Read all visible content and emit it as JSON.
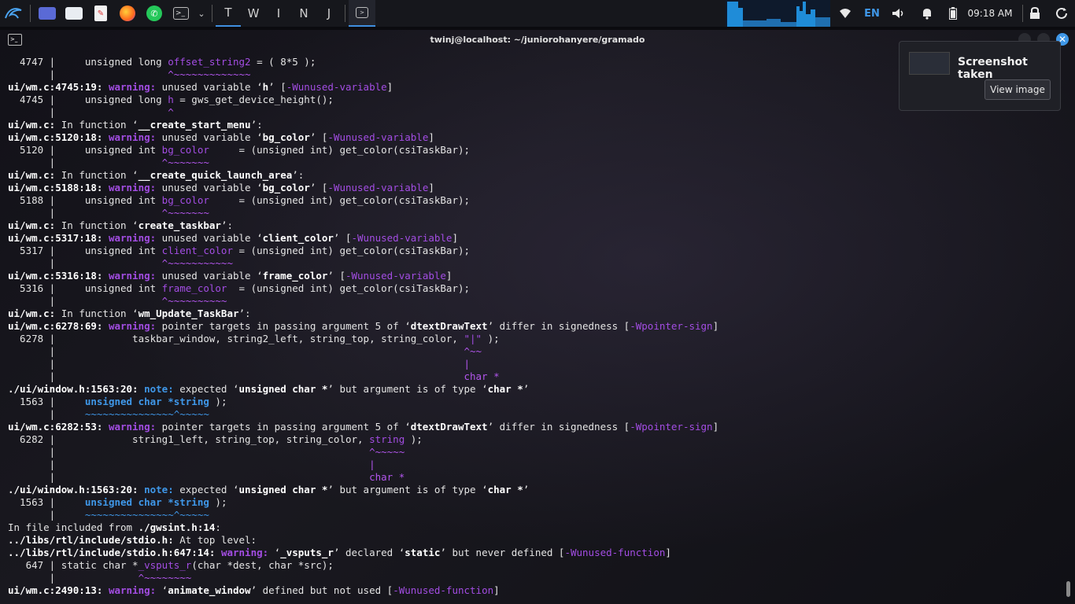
{
  "panel": {
    "workspaces": [
      "T",
      "W",
      "I",
      "N",
      "J"
    ],
    "keyboard_layout": "EN",
    "clock": "09:18 AM",
    "accent_color": "#3f8fe0",
    "icons": [
      "kali-menu-icon",
      "desktop-icon",
      "file-manager-icon",
      "text-editor-icon",
      "firefox-icon",
      "whatsapp-icon",
      "terminal-icon",
      "dropdown-icon",
      "wifi-icon",
      "volume-icon",
      "notifications-icon",
      "battery-icon",
      "lock-icon",
      "power-icon"
    ]
  },
  "terminal": {
    "title": "twinj@localhost: ~/juniorohanyere/gramado"
  },
  "notification": {
    "title": "Screenshot taken",
    "button": "View image"
  },
  "output": [
    [
      [
        "  4747 |     unsigned long ",
        ""
      ],
      [
        "offset_string2",
        "p"
      ],
      [
        " = ( 8*5 );",
        ""
      ]
    ],
    [
      [
        "       |                   ",
        ""
      ],
      [
        "^~~~~~~~~~~~~~",
        "c"
      ]
    ],
    [
      [
        "ui/wm.c:4745:19: ",
        "b"
      ],
      [
        "warning: ",
        "w"
      ],
      [
        "unused variable ‘",
        ""
      ],
      [
        "h",
        "b"
      ],
      [
        "’ [",
        ""
      ],
      [
        "-Wunused-variable",
        "p"
      ],
      [
        "]",
        ""
      ]
    ],
    [
      [
        "  4745 |     unsigned long ",
        ""
      ],
      [
        "h",
        "p"
      ],
      [
        " = gws_get_device_height();",
        ""
      ]
    ],
    [
      [
        "       |                   ",
        ""
      ],
      [
        "^",
        "c"
      ]
    ],
    [
      [
        "ui/wm.c:",
        "b"
      ],
      [
        " In function ‘",
        ""
      ],
      [
        "__create_start_menu",
        "b"
      ],
      [
        "’:",
        ""
      ]
    ],
    [
      [
        "ui/wm.c:5120:18: ",
        "b"
      ],
      [
        "warning: ",
        "w"
      ],
      [
        "unused variable ‘",
        ""
      ],
      [
        "bg_color",
        "b"
      ],
      [
        "’ [",
        ""
      ],
      [
        "-Wunused-variable",
        "p"
      ],
      [
        "]",
        ""
      ]
    ],
    [
      [
        "  5120 |     unsigned int ",
        ""
      ],
      [
        "bg_color",
        "p"
      ],
      [
        "     = (unsigned int) get_color(csiTaskBar);",
        ""
      ]
    ],
    [
      [
        "       |                  ",
        ""
      ],
      [
        "^~~~~~~~",
        "c"
      ]
    ],
    [
      [
        "ui/wm.c:",
        "b"
      ],
      [
        " In function ‘",
        ""
      ],
      [
        "__create_quick_launch_area",
        "b"
      ],
      [
        "’:",
        ""
      ]
    ],
    [
      [
        "ui/wm.c:5188:18: ",
        "b"
      ],
      [
        "warning: ",
        "w"
      ],
      [
        "unused variable ‘",
        ""
      ],
      [
        "bg_color",
        "b"
      ],
      [
        "’ [",
        ""
      ],
      [
        "-Wunused-variable",
        "p"
      ],
      [
        "]",
        ""
      ]
    ],
    [
      [
        "  5188 |     unsigned int ",
        ""
      ],
      [
        "bg_color",
        "p"
      ],
      [
        "     = (unsigned int) get_color(csiTaskBar);",
        ""
      ]
    ],
    [
      [
        "       |                  ",
        ""
      ],
      [
        "^~~~~~~~",
        "c"
      ]
    ],
    [
      [
        "ui/wm.c:",
        "b"
      ],
      [
        " In function ‘",
        ""
      ],
      [
        "create_taskbar",
        "b"
      ],
      [
        "’:",
        ""
      ]
    ],
    [
      [
        "ui/wm.c:5317:18: ",
        "b"
      ],
      [
        "warning: ",
        "w"
      ],
      [
        "unused variable ‘",
        ""
      ],
      [
        "client_color",
        "b"
      ],
      [
        "’ [",
        ""
      ],
      [
        "-Wunused-variable",
        "p"
      ],
      [
        "]",
        ""
      ]
    ],
    [
      [
        "  5317 |     unsigned int ",
        ""
      ],
      [
        "client_color",
        "p"
      ],
      [
        " = (unsigned int) get_color(csiTaskBar);",
        ""
      ]
    ],
    [
      [
        "       |                  ",
        ""
      ],
      [
        "^~~~~~~~~~~~",
        "c"
      ]
    ],
    [
      [
        "ui/wm.c:5316:18: ",
        "b"
      ],
      [
        "warning: ",
        "w"
      ],
      [
        "unused variable ‘",
        ""
      ],
      [
        "frame_color",
        "b"
      ],
      [
        "’ [",
        ""
      ],
      [
        "-Wunused-variable",
        "p"
      ],
      [
        "]",
        ""
      ]
    ],
    [
      [
        "  5316 |     unsigned int ",
        ""
      ],
      [
        "frame_color",
        "p"
      ],
      [
        "  = (unsigned int) get_color(csiTaskBar);",
        ""
      ]
    ],
    [
      [
        "       |                  ",
        ""
      ],
      [
        "^~~~~~~~~~~",
        "c"
      ]
    ],
    [
      [
        "ui/wm.c:",
        "b"
      ],
      [
        " In function ‘",
        ""
      ],
      [
        "wm_Update_TaskBar",
        "b"
      ],
      [
        "’:",
        ""
      ]
    ],
    [
      [
        "ui/wm.c:6278:69: ",
        "b"
      ],
      [
        "warning: ",
        "w"
      ],
      [
        "pointer targets in passing argument 5 of ‘",
        ""
      ],
      [
        "dtextDrawText",
        "b"
      ],
      [
        "’ differ in signedness [",
        ""
      ],
      [
        "-Wpointer-sign",
        "p"
      ],
      [
        "]",
        ""
      ]
    ],
    [
      [
        "  6278 |             taskbar_window, string2_left, string_top, string_color, ",
        ""
      ],
      [
        "\"|\"",
        "p"
      ],
      [
        " );",
        ""
      ]
    ],
    [
      [
        "       |                                                                     ",
        ""
      ],
      [
        "^~~",
        "c"
      ]
    ],
    [
      [
        "       |                                                                     ",
        ""
      ],
      [
        "|",
        "c"
      ]
    ],
    [
      [
        "       |                                                                     ",
        ""
      ],
      [
        "char *",
        "c"
      ]
    ],
    [
      [
        "./ui/window.h:1563:20: ",
        "b"
      ],
      [
        "note: ",
        "n"
      ],
      [
        "expected ‘",
        ""
      ],
      [
        "unsigned char *",
        "b"
      ],
      [
        "’ but argument is of type ‘",
        ""
      ],
      [
        "char *",
        "b"
      ],
      [
        "’",
        ""
      ]
    ],
    [
      [
        "  1563 |     ",
        ""
      ],
      [
        "unsigned char *string",
        "bb"
      ],
      [
        " );",
        ""
      ]
    ],
    [
      [
        "       |     ",
        ""
      ],
      [
        "~~~~~~~~~~~~~~~^~~~~~",
        "gb"
      ]
    ],
    [
      [
        "ui/wm.c:6282:53: ",
        "b"
      ],
      [
        "warning: ",
        "w"
      ],
      [
        "pointer targets in passing argument 5 of ‘",
        ""
      ],
      [
        "dtextDrawText",
        "b"
      ],
      [
        "’ differ in signedness [",
        ""
      ],
      [
        "-Wpointer-sign",
        "p"
      ],
      [
        "]",
        ""
      ]
    ],
    [
      [
        "  6282 |             string1_left, string_top, string_color, ",
        ""
      ],
      [
        "string",
        "p"
      ],
      [
        " );",
        ""
      ]
    ],
    [
      [
        "       |                                                     ",
        ""
      ],
      [
        "^~~~~~",
        "c"
      ]
    ],
    [
      [
        "       |                                                     ",
        ""
      ],
      [
        "|",
        "c"
      ]
    ],
    [
      [
        "       |                                                     ",
        ""
      ],
      [
        "char *",
        "c"
      ]
    ],
    [
      [
        "./ui/window.h:1563:20: ",
        "b"
      ],
      [
        "note: ",
        "n"
      ],
      [
        "expected ‘",
        ""
      ],
      [
        "unsigned char *",
        "b"
      ],
      [
        "’ but argument is of type ‘",
        ""
      ],
      [
        "char *",
        "b"
      ],
      [
        "’",
        ""
      ]
    ],
    [
      [
        "  1563 |     ",
        ""
      ],
      [
        "unsigned char *string",
        "bb"
      ],
      [
        " );",
        ""
      ]
    ],
    [
      [
        "       |     ",
        ""
      ],
      [
        "~~~~~~~~~~~~~~~^~~~~~",
        "gb"
      ]
    ],
    [
      [
        "In file included from ",
        ""
      ],
      [
        "./gwsint.h:14",
        "b"
      ],
      [
        ":",
        ""
      ]
    ],
    [
      [
        "../libs/rtl/include/stdio.h:",
        "b"
      ],
      [
        " At top level:",
        ""
      ]
    ],
    [
      [
        "../libs/rtl/include/stdio.h:647:14: ",
        "b"
      ],
      [
        "warning: ",
        "w"
      ],
      [
        "‘",
        ""
      ],
      [
        "_vsputs_r",
        "b"
      ],
      [
        "’ declared ‘",
        ""
      ],
      [
        "static",
        "b"
      ],
      [
        "’ but never defined [",
        ""
      ],
      [
        "-Wunused-function",
        "p"
      ],
      [
        "]",
        ""
      ]
    ],
    [
      [
        "   647 | static char *",
        ""
      ],
      [
        "_vsputs_r",
        "p"
      ],
      [
        "(char *dest, char *src);",
        ""
      ]
    ],
    [
      [
        "       |              ",
        ""
      ],
      [
        "^~~~~~~~~",
        "c"
      ]
    ],
    [
      [
        "ui/wm.c:2490:13: ",
        "b"
      ],
      [
        "warning: ",
        "w"
      ],
      [
        "‘",
        ""
      ],
      [
        "animate_window",
        "b"
      ],
      [
        "’ defined but not used [",
        ""
      ],
      [
        "-Wunused-function",
        "p"
      ],
      [
        "]",
        ""
      ]
    ]
  ]
}
